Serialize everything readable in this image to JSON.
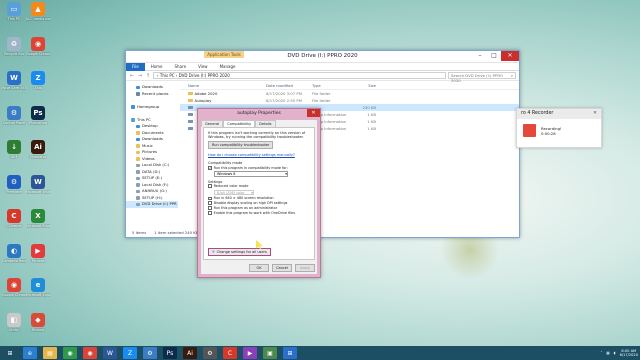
{
  "desktop": {
    "icons": [
      {
        "label": "This PC",
        "color": "#5aa0d8",
        "glyph": "▭"
      },
      {
        "label": "VLC media player",
        "color": "#f08a1c",
        "glyph": "▲"
      },
      {
        "label": "Recycle Bin",
        "color": "#9fb6c8",
        "glyph": "♻"
      },
      {
        "label": "Google Chrome",
        "color": "#db4437",
        "glyph": "◉"
      },
      {
        "label": "Wise Care 365",
        "color": "#2a6fc9",
        "glyph": "W"
      },
      {
        "label": "Zalo",
        "color": "#1a8cf0",
        "glyph": "Z"
      },
      {
        "label": "Control Panel",
        "color": "#3b7dc4",
        "glyph": "⚙"
      },
      {
        "label": "Photoshop",
        "color": "#0d2b4a",
        "glyph": "Ps"
      },
      {
        "label": "IDM",
        "color": "#2f7d32",
        "glyph": "↓"
      },
      {
        "label": "Illustrator",
        "color": "#3a1a0a",
        "glyph": "Ai"
      },
      {
        "label": "Premiere",
        "color": "#1f5fc0",
        "glyph": "⚙"
      },
      {
        "label": "Microsoft Word",
        "color": "#2b5797",
        "glyph": "W"
      },
      {
        "label": "CCleaner",
        "color": "#d8382a",
        "glyph": "C"
      },
      {
        "label": "Microsoft Edge",
        "color": "#2a8a3a",
        "glyph": "X"
      },
      {
        "label": "Camtasia Recorder",
        "color": "#2b79c2",
        "glyph": "◐"
      },
      {
        "label": "Filmora",
        "color": "#e23b3b",
        "glyph": "▶"
      },
      {
        "label": "Google Chrome",
        "color": "#db4437",
        "glyph": "◉"
      },
      {
        "label": "Microsoft Edge",
        "color": "#1f8ed8",
        "glyph": "e"
      },
      {
        "label": "Utility",
        "color": "#c9c9c9",
        "glyph": "◧"
      },
      {
        "label": "Ribbon",
        "color": "#d94a37",
        "glyph": "◆"
      }
    ]
  },
  "explorer": {
    "title": "DVD Drive (I:) PPRO 2020",
    "context_tab": "Application Tools",
    "ribbon": [
      "File",
      "Home",
      "Share",
      "View",
      "Manage"
    ],
    "address": "›  This PC  ›  DVD Drive (I:) PPRO 2020",
    "search_placeholder": "Search DVD Drive (I:) PPRO 2020",
    "nav": [
      {
        "label": "Downloads",
        "color": "#3a8fe0",
        "indent": 1
      },
      {
        "label": "Recent places",
        "color": "#6a86a6",
        "indent": 1
      },
      {
        "label": "",
        "color": "",
        "indent": 0
      },
      {
        "label": "Homegroup",
        "color": "#3a8fe0",
        "indent": 0
      },
      {
        "label": "",
        "color": "",
        "indent": 0
      },
      {
        "label": "This PC",
        "color": "#5aa0d8",
        "indent": 0
      },
      {
        "label": "Desktop",
        "color": "#3a8fe0",
        "indent": 1
      },
      {
        "label": "Documents",
        "color": "#e9c15b",
        "indent": 1
      },
      {
        "label": "Downloads",
        "color": "#3a8fe0",
        "indent": 1
      },
      {
        "label": "Music",
        "color": "#e9c15b",
        "indent": 1
      },
      {
        "label": "Pictures",
        "color": "#e9c15b",
        "indent": 1
      },
      {
        "label": "Videos",
        "color": "#e9c15b",
        "indent": 1
      },
      {
        "label": "Local Disk (C:)",
        "color": "#8a9fb3",
        "indent": 1
      },
      {
        "label": "DATA (D:)",
        "color": "#8a9fb3",
        "indent": 1
      },
      {
        "label": "SETUP (E:)",
        "color": "#8a9fb3",
        "indent": 1
      },
      {
        "label": "Local Disk (F:)",
        "color": "#8a9fb3",
        "indent": 1
      },
      {
        "label": "ANHBUU (G:)",
        "color": "#8a9fb3",
        "indent": 1
      },
      {
        "label": "SETUP (H:)",
        "color": "#8a9fb3",
        "indent": 1
      },
      {
        "label": "DVD Drive (I:) PPR",
        "color": "#8a9fb3",
        "indent": 1,
        "selected": true
      }
    ],
    "columns": [
      "Name",
      "Date modified",
      "Type",
      "Size"
    ],
    "files": [
      {
        "name": "Adobe 2020",
        "date": "6/17/2020 3:07 PM",
        "type": "File folder",
        "size": ""
      },
      {
        "name": "Autoplay",
        "date": "6/17/2020 2:55 PM",
        "type": "File folder",
        "size": ""
      },
      {
        "name": "",
        "date": "",
        "type": "",
        "size": "230 KB",
        "selected": true
      },
      {
        "name": "",
        "date": "",
        "type": "Setup Information",
        "size": "1 KB"
      },
      {
        "name": "",
        "date": "",
        "type": "Setup Information",
        "size": "1 KB"
      },
      {
        "name": "",
        "date": "",
        "type": "Setup Information",
        "size": "1 KB"
      }
    ],
    "status": [
      "5 items",
      "1 item selected  240 KB"
    ]
  },
  "dialog": {
    "title": "autoplay Properties",
    "tabs": [
      "General",
      "Compatibility",
      "Details"
    ],
    "active_tab": 1,
    "intro": "If this program isn't working correctly on this version of Windows, try running the compatibility troubleshooter.",
    "troubleshooter_btn": "Run compatibility troubleshooter",
    "link": "How do I choose compatibility settings manually?",
    "compat_mode_label": "Compatibility mode",
    "compat_check": "Run this program in compatibility mode for:",
    "compat_os": "Windows 8",
    "settings_label": "Settings",
    "settings": [
      {
        "label": "Reduced color mode",
        "checked": false,
        "disabled": false
      },
      {
        "label": "Run in 640 × 480 screen resolution",
        "checked": false,
        "disabled": false
      },
      {
        "label": "Disable display scaling on high DPI settings",
        "checked": false,
        "disabled": false
      },
      {
        "label": "Run this program as an administrator",
        "checked": false,
        "disabled": false
      },
      {
        "label": "Enable this program to work with OneDrive files",
        "checked": false,
        "disabled": false
      }
    ],
    "color_select": "8-bit (256) color",
    "all_users_btn": "Change settings for all users",
    "ok": "OK",
    "cancel": "Cancel",
    "apply": "Apply"
  },
  "recorder": {
    "title": "ro 4 Recorder",
    "status": "Recording!",
    "time": "0:00:28"
  },
  "taskbar": {
    "apps": [
      {
        "name": "start",
        "color": "#1c4f63",
        "glyph": "⊞"
      },
      {
        "name": "ie",
        "color": "#2a7fd0",
        "glyph": "e"
      },
      {
        "name": "explorer",
        "color": "#e5b64a",
        "glyph": "▤"
      },
      {
        "name": "camtasia",
        "color": "#2f9a4a",
        "glyph": "◉"
      },
      {
        "name": "chrome",
        "color": "#db4437",
        "glyph": "◉"
      },
      {
        "name": "word",
        "color": "#2b5797",
        "glyph": "W"
      },
      {
        "name": "zalo",
        "color": "#1a8cf0",
        "glyph": "Z"
      },
      {
        "name": "control",
        "color": "#3b7dc4",
        "glyph": "⚙"
      },
      {
        "name": "ps",
        "color": "#0d2b4a",
        "glyph": "Ps"
      },
      {
        "name": "ai",
        "color": "#3a1a0a",
        "glyph": "Ai"
      },
      {
        "name": "settings",
        "color": "#555",
        "glyph": "⚙"
      },
      {
        "name": "ccleaner",
        "color": "#d8382a",
        "glyph": "C"
      },
      {
        "name": "media",
        "color": "#8c3fb8",
        "glyph": "▶"
      },
      {
        "name": "photos",
        "color": "#4a8a4a",
        "glyph": "▣"
      },
      {
        "name": "windows",
        "color": "#2a6fc9",
        "glyph": "⊞"
      }
    ],
    "time": "8:00 AM",
    "date": "6/17/2020"
  }
}
